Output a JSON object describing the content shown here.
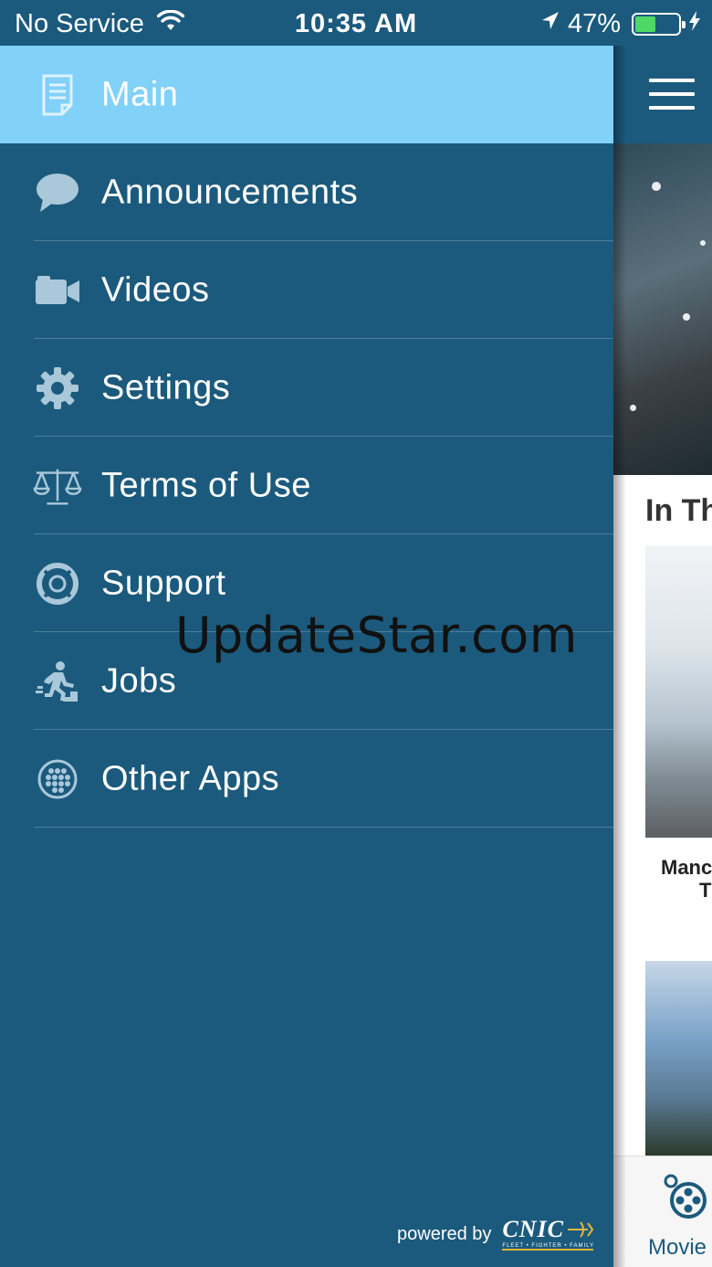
{
  "status_bar": {
    "carrier": "No Service",
    "time": "10:35 AM",
    "battery_percent": "47%",
    "battery_level": 0.47,
    "icons": [
      "wifi-icon",
      "location-arrow-icon",
      "battery-icon",
      "charging-bolt-icon"
    ]
  },
  "drawer": {
    "items": [
      {
        "label": "Main",
        "icon": "document-icon",
        "active": true
      },
      {
        "label": "Announcements",
        "icon": "speech-bubble-icon"
      },
      {
        "label": "Videos",
        "icon": "video-camera-icon"
      },
      {
        "label": "Settings",
        "icon": "gear-icon"
      },
      {
        "label": "Terms of Use",
        "icon": "scales-icon"
      },
      {
        "label": "Support",
        "icon": "lifebuoy-icon"
      },
      {
        "label": "Jobs",
        "icon": "running-person-icon"
      },
      {
        "label": "Other Apps",
        "icon": "app-grid-icon"
      }
    ],
    "footer": {
      "powered_by": "powered by",
      "logo_text": "CNIC",
      "logo_tagline": "FLEET • FIGHTER • FAMILY"
    }
  },
  "watermark": "UpdateStar.com",
  "background_app": {
    "section_title": "In Th",
    "movie_caption_line1": "Manc",
    "movie_caption_line2": "T",
    "tab_label": "Movie"
  },
  "colors": {
    "drawer_bg": "#1b5a7d",
    "active_item_bg": "#81d1f9",
    "divider": "#4b7d9a",
    "battery_fill": "#4cd964"
  }
}
